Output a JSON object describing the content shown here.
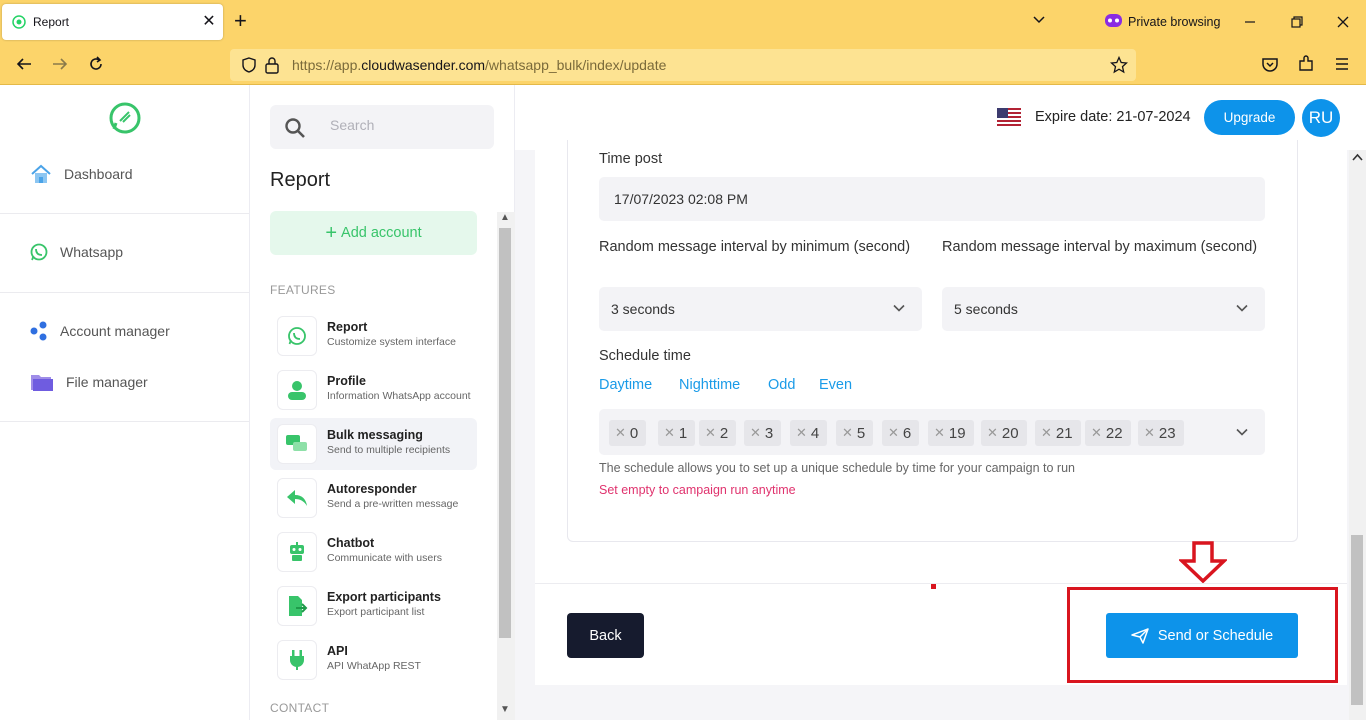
{
  "browser": {
    "tab_title": "Report",
    "private_label": "Private browsing",
    "url_prefix": "https://app.",
    "url_domain": "cloudwasender.com",
    "url_path": "/whatsapp_bulk/index/update"
  },
  "leftnav": {
    "items": [
      {
        "label": "Dashboard",
        "icon": "home-icon"
      },
      {
        "label": "Whatsapp",
        "icon": "whatsapp-icon"
      },
      {
        "label": "Account manager",
        "icon": "share-icon"
      },
      {
        "label": "File manager",
        "icon": "folder-icon"
      }
    ]
  },
  "panel": {
    "search_placeholder": "Search",
    "title": "Report",
    "add_account": "Add account",
    "features_label": "FEATURES",
    "contact_label": "CONTACT",
    "features": [
      {
        "title": "Report",
        "desc": "Customize system interface",
        "icon": "whatsapp-icon"
      },
      {
        "title": "Profile",
        "desc": "Information WhatsApp account",
        "icon": "user-icon"
      },
      {
        "title": "Bulk messaging",
        "desc": "Send to multiple recipients",
        "icon": "chat-icon"
      },
      {
        "title": "Autoresponder",
        "desc": "Send a pre-written message",
        "icon": "reply-icon"
      },
      {
        "title": "Chatbot",
        "desc": "Communicate with users",
        "icon": "robot-icon"
      },
      {
        "title": "Export participants",
        "desc": "Export participant list",
        "icon": "export-icon"
      },
      {
        "title": "API",
        "desc": "API WhatApp REST",
        "icon": "plug-icon"
      }
    ]
  },
  "topbar": {
    "expire": "Expire date: 21-07-2024",
    "upgrade": "Upgrade",
    "avatar": "RU"
  },
  "form": {
    "time_post_label": "Time post",
    "time_post_value": "17/07/2023 02:08 PM",
    "min_label": "Random message interval by minimum (second)",
    "min_value": "3 seconds",
    "max_label": "Random message interval by maximum (second)",
    "max_value": "5 seconds",
    "schedule_label": "Schedule time",
    "quick_options": [
      "Daytime",
      "Nighttime",
      "Odd",
      "Even"
    ],
    "hours": [
      "0",
      "1",
      "2",
      "3",
      "4",
      "5",
      "6",
      "19",
      "20",
      "21",
      "22",
      "23"
    ],
    "help": "The schedule allows you to set up a unique schedule by time for your campaign to run",
    "warn": "Set empty to campaign run anytime",
    "back": "Back",
    "send": "Send or Schedule"
  },
  "colors": {
    "accent": "#0d93ea",
    "brand_green": "#38c46a",
    "highlight_red": "#d9151f",
    "browser_chrome": "#fcd46a"
  }
}
